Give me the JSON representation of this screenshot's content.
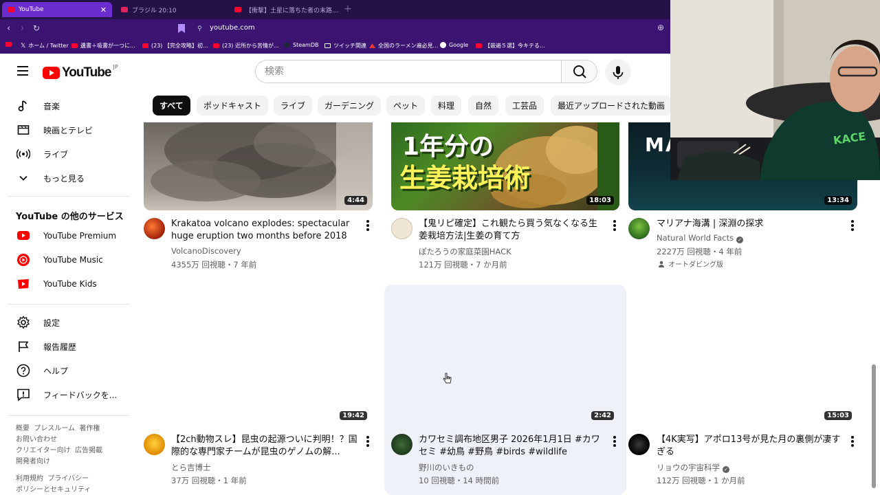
{
  "browser": {
    "tabs": [
      {
        "label": "YouTube",
        "active": true
      },
      {
        "label": "ブラジル 20:10",
        "active": false
      },
      {
        "label": "【衝撃】土星に落ちた者の末路...... - You",
        "active": false
      }
    ],
    "url": "youtube.com",
    "bookmarks": [
      "ホーム / Twitter",
      "遺書＋吸書が一つに...",
      "(23) 【完全攻略】初...",
      "(23) 近所から苦情が...",
      "SteamDB",
      "ツイッチ関連",
      "全国のラーメン遍必見...",
      "Google",
      "【嵌遍５選】今キテる..."
    ]
  },
  "header": {
    "logo_text": "YouTube",
    "logo_region": "JP",
    "search_placeholder": "検索"
  },
  "sidebar": {
    "top_items": [
      {
        "label": "音楽",
        "icon": "music-note-icon"
      },
      {
        "label": "映画とテレビ",
        "icon": "film-icon"
      },
      {
        "label": "ライブ",
        "icon": "live-icon"
      },
      {
        "label": "もっと見る",
        "icon": "chevron-down-icon"
      }
    ],
    "services_title": "YouTube の他のサービス",
    "services": [
      {
        "label": "YouTube Premium"
      },
      {
        "label": "YouTube Music"
      },
      {
        "label": "YouTube Kids"
      }
    ],
    "settings_items": [
      {
        "label": "設定",
        "icon": "gear-icon"
      },
      {
        "label": "報告履歴",
        "icon": "flag-icon"
      },
      {
        "label": "ヘルプ",
        "icon": "help-icon"
      },
      {
        "label": "フィードバックを...",
        "icon": "feedback-icon"
      }
    ],
    "footer1": [
      "概要",
      "プレスルーム",
      "著作権",
      "お問い合わせ",
      "クリエイター向け",
      "広告掲載",
      "開発者向け"
    ],
    "footer2": [
      "利用規約",
      "プライバシー",
      "ポリシーとセキュリティ"
    ]
  },
  "chips": [
    "すべて",
    "ポッドキャスト",
    "ライブ",
    "ガーデニング",
    "ペット",
    "料理",
    "自然",
    "工芸品",
    "最近アップロードされた動画"
  ],
  "videos": [
    {
      "title": "Krakatoa volcano explodes: spectacular huge eruption two months before 2018 tsunami",
      "channel": "VolcanoDiscovery",
      "meta": "4355万 回視聴・7 年前",
      "duration": "4:44",
      "verified": false
    },
    {
      "title": "【鬼リピ確定】これ観たら買う気なくなる生姜栽培方法|生姜の育て方",
      "channel": "ぽたろうの家庭菜園HACK",
      "meta": "121万 回視聴・7 か月前",
      "duration": "18:03",
      "verified": false,
      "thumb_text": [
        "1年分の",
        "生姜栽培術"
      ]
    },
    {
      "title": "マリアナ海溝 | 深淵の探求",
      "channel": "Natural World Facts",
      "meta": "2227万 回視聴・4 年前",
      "duration": "13:34",
      "verified": true,
      "badge": "オートダビング版",
      "thumb_text": [
        "MA"
      ]
    },
    {
      "title": "【2ch動物スレ】昆虫の起源ついに判明！？国際的な専門家チームが昆虫のゲノムの解...",
      "channel": "とら吉博士",
      "meta": "37万 回視聴・1 年前",
      "duration": "19:42",
      "verified": false
    },
    {
      "title": "カワセミ調布地区男子 2026年1月1日 #カワセミ #幼鳥 #野鳥 #birds #wildlife #nature #...",
      "channel": "野川のいきもの",
      "meta": "10 回視聴・14 時間前",
      "duration": "2:42",
      "verified": false
    },
    {
      "title": "【4K実写】アポロ13号が見た月の裏側が凄すぎる",
      "channel": "リョウの宇宙科学",
      "meta": "112万 回視聴・1 か月前",
      "duration": "15:03",
      "verified": true
    }
  ],
  "colors": {
    "accent": "#ff0000",
    "chrome": "#3a1470",
    "tabbar": "#241146"
  }
}
